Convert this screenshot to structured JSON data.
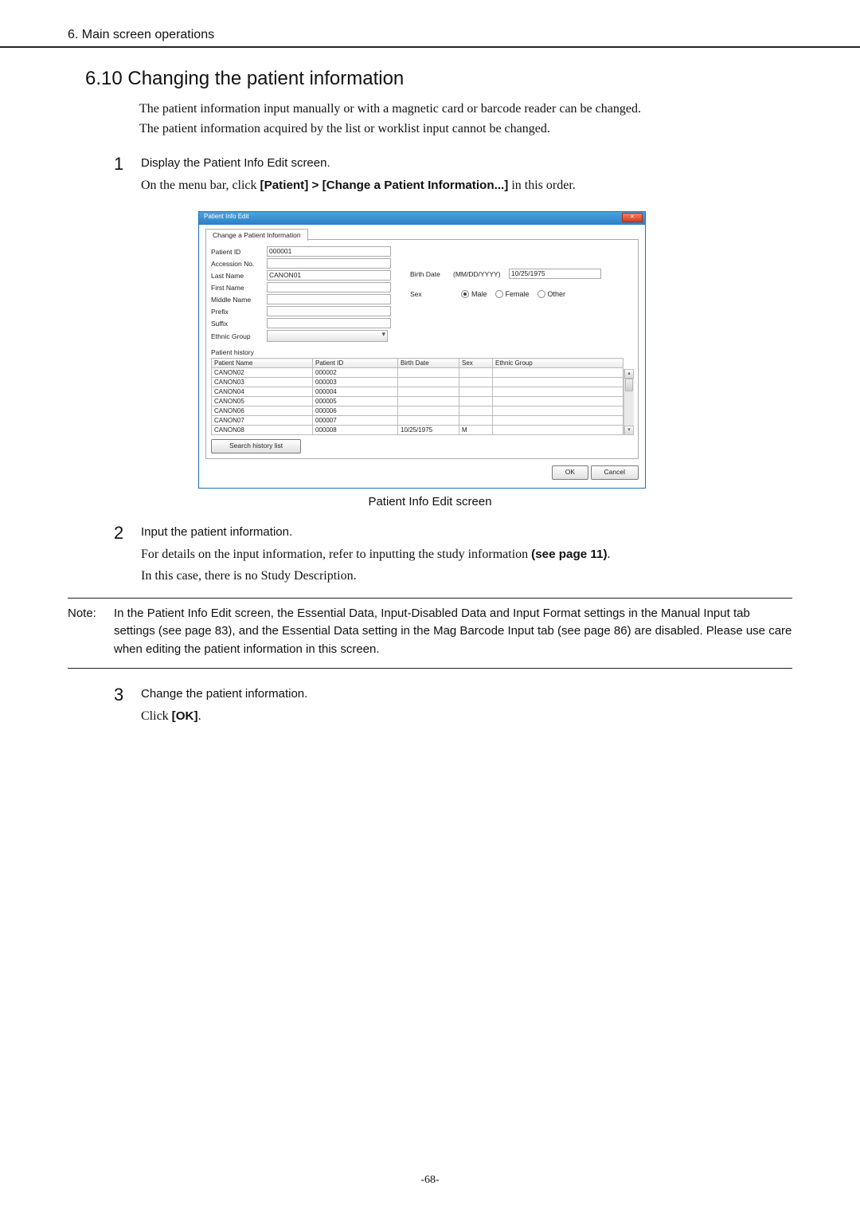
{
  "header": "6. Main screen operations",
  "section_title": "6.10 Changing the patient information",
  "intro_1": "The patient information input manually or with a magnetic card or barcode reader can be changed.",
  "intro_2": "The patient information acquired by the list or worklist input cannot be changed.",
  "steps": {
    "s1_num": "1",
    "s1_title": "Display the Patient Info Edit screen.",
    "s1_desc_a": "On the menu bar, click ",
    "s1_desc_b": "[Patient] > [Change a Patient Information...]",
    "s1_desc_c": " in this order.",
    "s2_num": "2",
    "s2_title": "Input the patient information.",
    "s2_desc_a": "For details on the input information, refer to inputting the study information ",
    "s2_desc_b": "(see page 11)",
    "s2_desc_c": ".",
    "s2_desc_2": "In this case, there is no Study Description.",
    "s3_num": "3",
    "s3_title": "Change the patient information.",
    "s3_desc_a": "Click ",
    "s3_desc_b": "[OK]",
    "s3_desc_c": "."
  },
  "note": {
    "label": "Note:",
    "text": "In the Patient Info Edit screen, the Essential Data, Input-Disabled Data and Input Format settings in the Manual Input tab settings (see page 83), and the Essential Data setting in the Mag Barcode Input tab (see page 86) are disabled. Please use care when editing the patient information in this screen."
  },
  "dialog": {
    "title": "Patient Info Edit",
    "tab": "Change a Patient Information",
    "fields": {
      "patient_id_l": "Patient ID",
      "patient_id_v": "000001",
      "accession_l": "Accession No.",
      "last_name_l": "Last Name",
      "last_name_v": "CANON01",
      "first_name_l": "First Name",
      "middle_name_l": "Middle Name",
      "prefix_l": "Prefix",
      "suffix_l": "Suffix",
      "ethnic_l": "Ethnic Group",
      "birth_l": "Birth Date",
      "birth_hint": "(MM/DD/YYYY)",
      "birth_v": "10/25/1975",
      "sex_l": "Sex",
      "sex_male": "Male",
      "sex_female": "Female",
      "sex_other": "Other"
    },
    "history_title": "Patient history",
    "cols": {
      "name": "Patient Name",
      "id": "Patient ID",
      "birth": "Birth Date",
      "sex": "Sex",
      "eth": "Ethnic Group"
    },
    "rows": [
      {
        "name": "CANON02",
        "id": "000002",
        "birth": "",
        "sex": "",
        "eth": ""
      },
      {
        "name": "CANON03",
        "id": "000003",
        "birth": "",
        "sex": "",
        "eth": ""
      },
      {
        "name": "CANON04",
        "id": "000004",
        "birth": "",
        "sex": "",
        "eth": ""
      },
      {
        "name": "CANON05",
        "id": "000005",
        "birth": "",
        "sex": "",
        "eth": ""
      },
      {
        "name": "CANON06",
        "id": "000006",
        "birth": "",
        "sex": "",
        "eth": ""
      },
      {
        "name": "CANON07",
        "id": "000007",
        "birth": "",
        "sex": "",
        "eth": ""
      },
      {
        "name": "CANON08",
        "id": "000008",
        "birth": "10/25/1975",
        "sex": "M",
        "eth": ""
      }
    ],
    "search_btn": "Search history list",
    "ok": "OK",
    "cancel": "Cancel"
  },
  "caption": "Patient Info Edit screen",
  "page_num": "-68-"
}
